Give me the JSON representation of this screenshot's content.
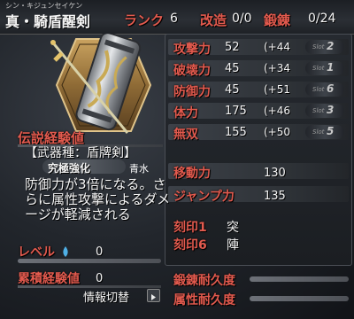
{
  "weapon": {
    "furigana": "シン・キジュンセイケン",
    "name": "真・騎盾醒剣"
  },
  "header": {
    "rank_label": "ランク",
    "rank_value": "6",
    "kaizou_label": "改造",
    "kaizou_value": "0/0",
    "tanren_label": "鍛錬",
    "tanren_value": "0/24"
  },
  "stats": [
    {
      "label": "攻撃力",
      "value": "52",
      "bonus": "(+44",
      "slot": "2"
    },
    {
      "label": "破壊力",
      "value": "45",
      "bonus": "(+34",
      "slot": "1"
    },
    {
      "label": "防御力",
      "value": "45",
      "bonus": "(+51",
      "slot": "6"
    },
    {
      "label": "体力",
      "value": "175",
      "bonus": "(+46",
      "slot": "3"
    },
    {
      "label": "無双",
      "value": "155",
      "bonus": "(+50",
      "slot": "5"
    }
  ],
  "slot_prefix": "Slot",
  "mobility": {
    "move_label": "移動力",
    "move_value": "130",
    "jump_label": "ジャンプ力",
    "jump_value": "135"
  },
  "seals": [
    {
      "label": "刻印1",
      "value": "突"
    },
    {
      "label": "刻印6",
      "value": "陣"
    }
  ],
  "durability": {
    "tanren_label": "鍛錬耐久度",
    "attr_label": "属性耐久度"
  },
  "legend_exp": {
    "label": "伝説経験値"
  },
  "skill": {
    "weapon_type": "【武器種：盾牌剣】",
    "name": "究極強化",
    "attribute": "青水",
    "description": "防御力が3倍になる。さらに属性攻撃によるダメージが軽減される"
  },
  "level": {
    "label": "レベル",
    "value": "0"
  },
  "cumulative_exp": {
    "label": "累積経験値",
    "value": "0"
  },
  "info_toggle": {
    "label": "情報切替"
  },
  "colors": {
    "label_red": "#e25a4e",
    "panel_bg": "#1b1e22"
  }
}
